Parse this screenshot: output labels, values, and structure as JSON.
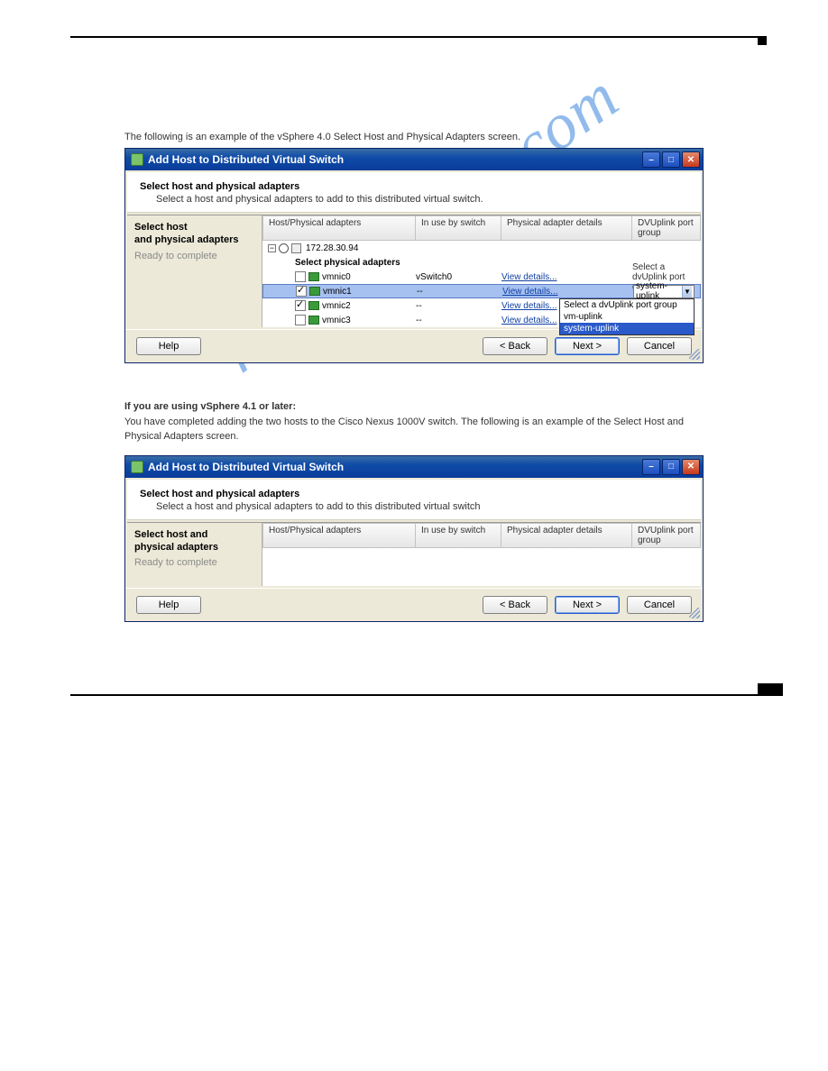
{
  "dialog1": {
    "title": "Add Host to Distributed Virtual Switch",
    "header_title": "Select host and physical adapters",
    "header_sub": "Select a host and physical adapters to add to this distributed virtual switch.",
    "nav": {
      "line1": "Select host",
      "line2": "and physical adapters",
      "ready": "Ready to complete"
    },
    "columns": [
      "Host/Physical adapters",
      "In use by switch",
      "Physical adapter details",
      "DVUplink port group"
    ],
    "host_ip": "172.28.30.94",
    "section": "Select physical adapters",
    "rows": [
      {
        "checked": false,
        "name": "vmnic0",
        "inuse": "vSwitch0",
        "details": "View details...",
        "uplink_plain": "Select a dvUplink port g..."
      },
      {
        "checked": true,
        "name": "vmnic1",
        "inuse": "--",
        "details": "View details...",
        "uplink_dropdown": "system-uplink",
        "selected": true
      },
      {
        "checked": true,
        "name": "vmnic2",
        "inuse": "--",
        "details": "View details...",
        "uplink_plain": ""
      },
      {
        "checked": false,
        "name": "vmnic3",
        "inuse": "--",
        "details": "View details...",
        "uplink_plain": ""
      }
    ],
    "dropdown_options": [
      "Select a dvUplink port group",
      "vm-uplink",
      "system-uplink"
    ],
    "buttons": {
      "help": "Help",
      "back": "< Back",
      "next": "Next >",
      "cancel": "Cancel"
    }
  },
  "mid_note_lead": "If you are using vSphere 4.1 or later:",
  "mid_note": "You have completed adding the two hosts to the Cisco Nexus 1000V switch. The following is an example of the Select Host and Physical Adapters screen.",
  "dialog2": {
    "title": "Add Host to Distributed Virtual Switch",
    "header_title": "Select host and physical adapters",
    "header_sub": "Select a host and physical adapters to add to this distributed virtual switch",
    "nav": {
      "line1": "Select host and",
      "line2": "physical adapters",
      "ready": "Ready to complete"
    },
    "columns": [
      "Host/Physical adapters",
      "In use by switch",
      "Physical adapter details",
      "DVUplink port group"
    ],
    "buttons": {
      "help": "Help",
      "back": "< Back",
      "next": "Next >",
      "cancel": "Cancel"
    }
  },
  "watermark": "manualshive.com"
}
